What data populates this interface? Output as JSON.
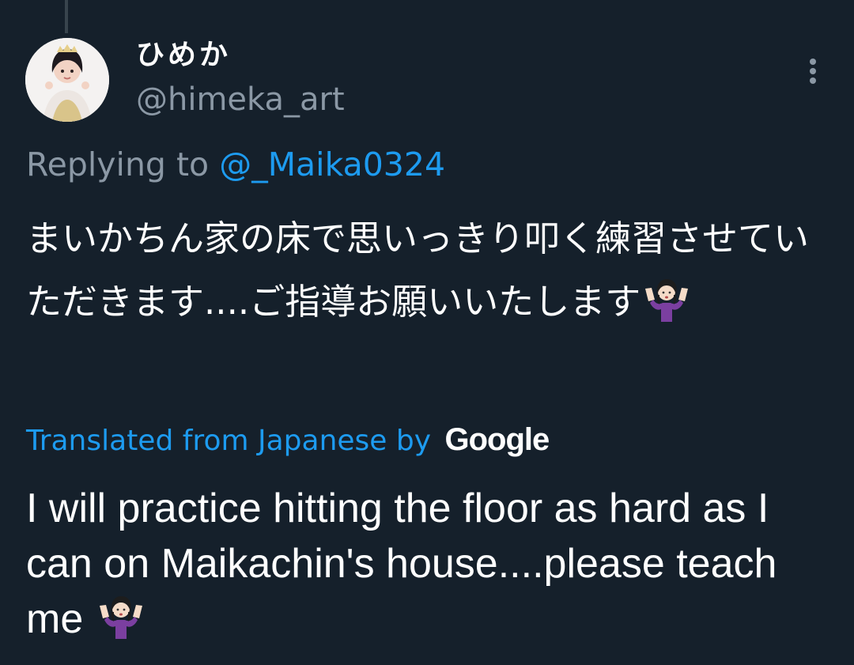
{
  "tweet": {
    "author": {
      "display_name": "ひめか",
      "handle": "@himeka_art",
      "avatar_icon": "avatar-photo"
    },
    "more_icon": "more-vertical-icon",
    "replying": {
      "prefix": "Replying to ",
      "mention": "@_Maika0324"
    },
    "text": "まいかちん家の床で思いっきり叩く練習させていただきます....ご指導お願いいたします",
    "text_emoji": "person-shrugging-emoji",
    "translation_note": {
      "label": "Translated from Japanese by",
      "provider": "Google"
    },
    "translation": "I will practice hitting the floor as hard as I can on Maikachin's house....please teach me",
    "translation_emoji": "person-shrugging-emoji"
  },
  "colors": {
    "background": "#15202b",
    "text_primary": "#ffffff",
    "text_secondary": "#8b98a5",
    "accent": "#1d9bf0"
  }
}
